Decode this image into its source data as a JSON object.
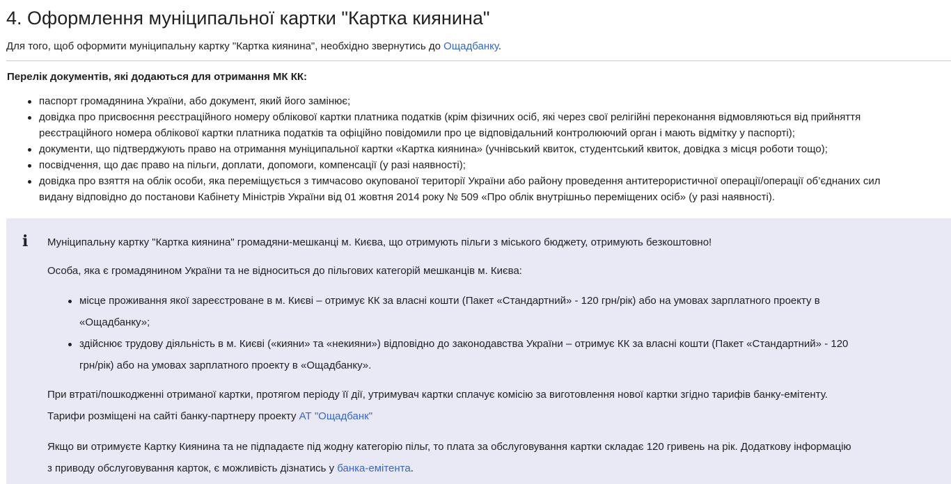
{
  "section": {
    "heading": "4. Оформлення муніципальної картки \"Картка киянина\"",
    "intro_text": "Для того, щоб оформити муніципальну картку \"Картка киянина\", необхідно звернутись до ",
    "intro_link": "Ощадбанку",
    "intro_end": "."
  },
  "documents": {
    "title": "Перелік документів, які додаються для отримання МК КК:",
    "items": [
      {
        "line1": "паспорт громадянина України, або документ, який його замінює;",
        "line2": ""
      },
      {
        "line1": "довідка про присвоєння реєстраційного номеру облікової картки платника податків (крім фізичних осіб, які через свої релігійні переконання відмовляються від прийняття",
        "line2": "реєстраційного номера облікової картки платника податків та офіційно повідомили про це відповідальний контролюючий орган і мають відмітку у паспорті);"
      },
      {
        "line1": "документи, що підтверджують право на отримання муніципальної картки «Картка киянина» (учнівський квиток, студентський квиток, довідка з місця роботи тощо);",
        "line2": ""
      },
      {
        "line1": "посвідчення, що дає право на пільги, доплати, допомоги, компенсації (у разі наявності);",
        "line2": ""
      },
      {
        "line1": "довідка про взяття на облік особи, яка переміщується з тимчасово окупованої території України або району проведення антитерористичної операції/операції об’єднаних сил",
        "line2": "видану відповідно до постанови Кабінету Міністрів України від 01 жовтня 2014 року № 509 «Про облік внутрішньо переміщених осіб» (у разі наявності)."
      }
    ]
  },
  "info": {
    "icon": "i",
    "p1": "Муніципальну картку \"Картка киянина\" громадяни-мешканці м. Києва, що отримують пільги з міського бюджету, отримують безкоштовно!",
    "p2": "Особа, яка є громадянином України та не відноситься до пільгових категорій мешканців м. Києва:",
    "items": [
      {
        "line1": "місце проживання якої зареєстроване в м. Києві – отримує КК за власні кошти (Пакет «Стандартний» - 120 грн/рік) або на умовах зарплатного проекту в",
        "line2": "«Ощадбанку»;"
      },
      {
        "line1": "здійснює трудову діяльність в м. Києві («кияни» та «некияни») відповідно до законодавства України – отримує КК за власні кошти (Пакет «Стандартний» - 120",
        "line2": "грн/рік) або на умовах зарплатного проекту в «Ощадбанку»."
      }
    ],
    "p3_line1": "При втраті/пошкодженні отриманої картки, протягом періоду її дії, утримувач картки сплачує комісію за виготовлення нової картки згідно тарифів банку-емітенту.",
    "p3_line2": "Тарифи розміщені на сайті банку-партнеру проекту ",
    "p3_link": "АТ \"Ощадбанк\"",
    "p4_line1": "Якщо ви отримуєте Картку Киянина та не підпадаєте під жодну категорію пільг, то плата за обслуговування картки складає 120 гривень на рік. Додаткову інформацію",
    "p4_line2": "з приводу обслуговування карток, є можливість дізнатись у ",
    "p4_link": "банка-емітента",
    "p4_end": "."
  }
}
